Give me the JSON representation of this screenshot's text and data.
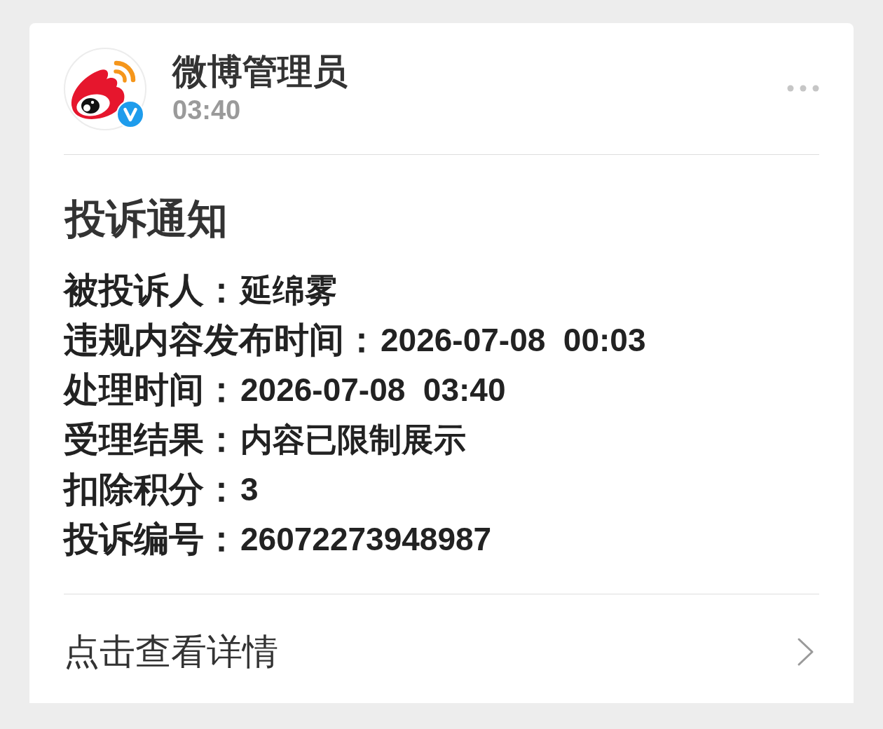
{
  "header": {
    "name": "微博管理员",
    "time": "03:40",
    "verified": true
  },
  "notice": {
    "title": "投诉通知",
    "fields": [
      {
        "label": "被投诉人：",
        "value": "延绵雾"
      },
      {
        "label": "违规内容发布时间：",
        "value": "2026-07-08  00:03"
      },
      {
        "label": "处理时间：",
        "value": "2026-07-08  03:40"
      },
      {
        "label": "受理结果：",
        "value": "内容已限制展示"
      },
      {
        "label": "扣除积分：",
        "value": "3"
      },
      {
        "label": "投诉编号：",
        "value": "26072273948987"
      }
    ]
  },
  "footer": {
    "link": "点击查看详情"
  }
}
